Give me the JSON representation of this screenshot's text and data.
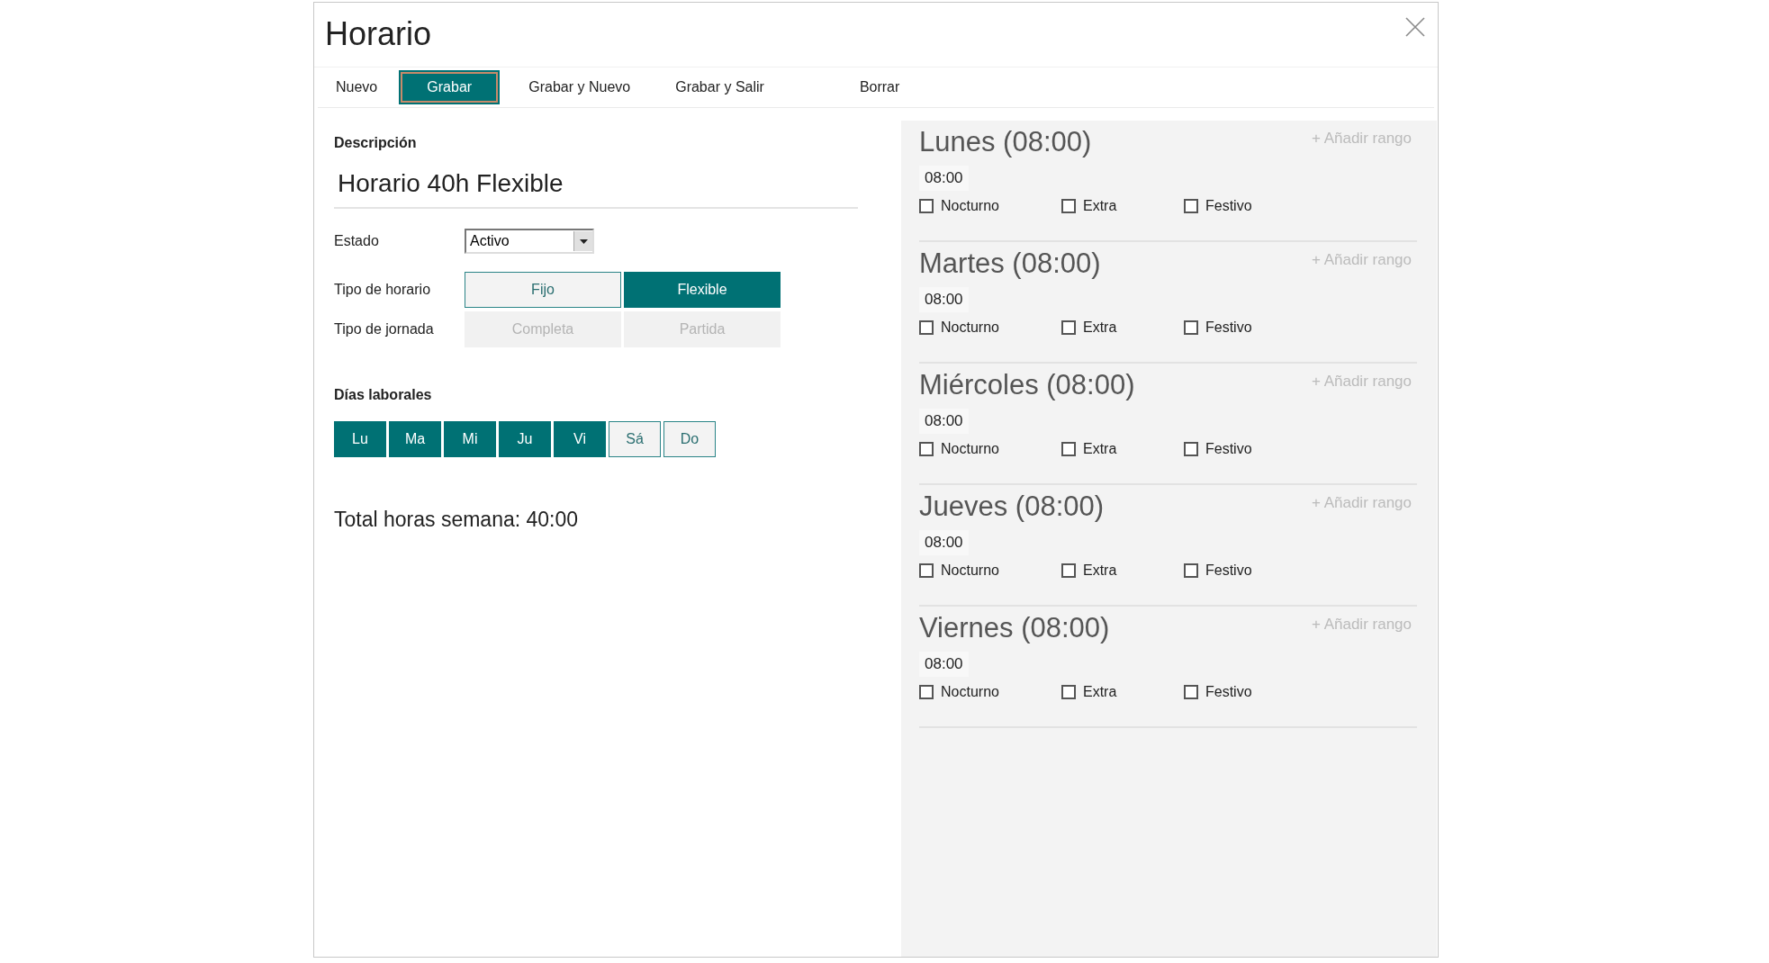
{
  "window": {
    "title": "Horario"
  },
  "toolbar": [
    {
      "label": "Nuevo",
      "selected": false
    },
    {
      "label": "Grabar",
      "selected": true
    },
    {
      "label": "Grabar y Nuevo",
      "selected": false
    },
    {
      "label": "Grabar y Salir",
      "selected": false
    },
    {
      "label": "Borrar",
      "selected": false
    }
  ],
  "form": {
    "description_label": "Descripción",
    "description_value": "Horario 40h Flexible",
    "estado": {
      "label": "Estado",
      "value": "Activo"
    },
    "tipo_horario": {
      "label": "Tipo de horario",
      "disabled": false,
      "options": [
        {
          "label": "Fijo",
          "selected": false
        },
        {
          "label": "Flexible",
          "selected": true
        }
      ]
    },
    "tipo_jornada": {
      "label": "Tipo de jornada",
      "disabled": true,
      "options": [
        {
          "label": "Completa"
        },
        {
          "label": "Partida"
        }
      ]
    },
    "dias_label": "Días laborales",
    "dias": [
      {
        "label": "Lu",
        "selected": true
      },
      {
        "label": "Ma",
        "selected": true
      },
      {
        "label": "Mi",
        "selected": true
      },
      {
        "label": "Ju",
        "selected": true
      },
      {
        "label": "Vi",
        "selected": true
      },
      {
        "label": "Sá",
        "selected": false
      },
      {
        "label": "Do",
        "selected": false
      }
    ],
    "total": "Total horas semana: 40:00"
  },
  "days": [
    {
      "title": "Lunes (08:00)",
      "add_range": "+ Añadir rango",
      "time": "08:00",
      "checks": [
        {
          "label": "Nocturno",
          "checked": false
        },
        {
          "label": "Extra",
          "checked": false
        },
        {
          "label": "Festivo",
          "checked": false
        }
      ]
    },
    {
      "title": "Martes (08:00)",
      "add_range": "+ Añadir rango",
      "time": "08:00",
      "checks": [
        {
          "label": "Nocturno",
          "checked": false
        },
        {
          "label": "Extra",
          "checked": false
        },
        {
          "label": "Festivo",
          "checked": false
        }
      ]
    },
    {
      "title": "Miércoles (08:00)",
      "add_range": "+ Añadir rango",
      "time": "08:00",
      "checks": [
        {
          "label": "Nocturno",
          "checked": false
        },
        {
          "label": "Extra",
          "checked": false
        },
        {
          "label": "Festivo",
          "checked": false
        }
      ]
    },
    {
      "title": "Jueves (08:00)",
      "add_range": "+ Añadir rango",
      "time": "08:00",
      "checks": [
        {
          "label": "Nocturno",
          "checked": false
        },
        {
          "label": "Extra",
          "checked": false
        },
        {
          "label": "Festivo",
          "checked": false
        }
      ]
    },
    {
      "title": "Viernes (08:00)",
      "add_range": "+ Añadir rango",
      "time": "08:00",
      "checks": [
        {
          "label": "Nocturno",
          "checked": false
        },
        {
          "label": "Extra",
          "checked": false
        },
        {
          "label": "Festivo",
          "checked": false
        }
      ]
    }
  ]
}
